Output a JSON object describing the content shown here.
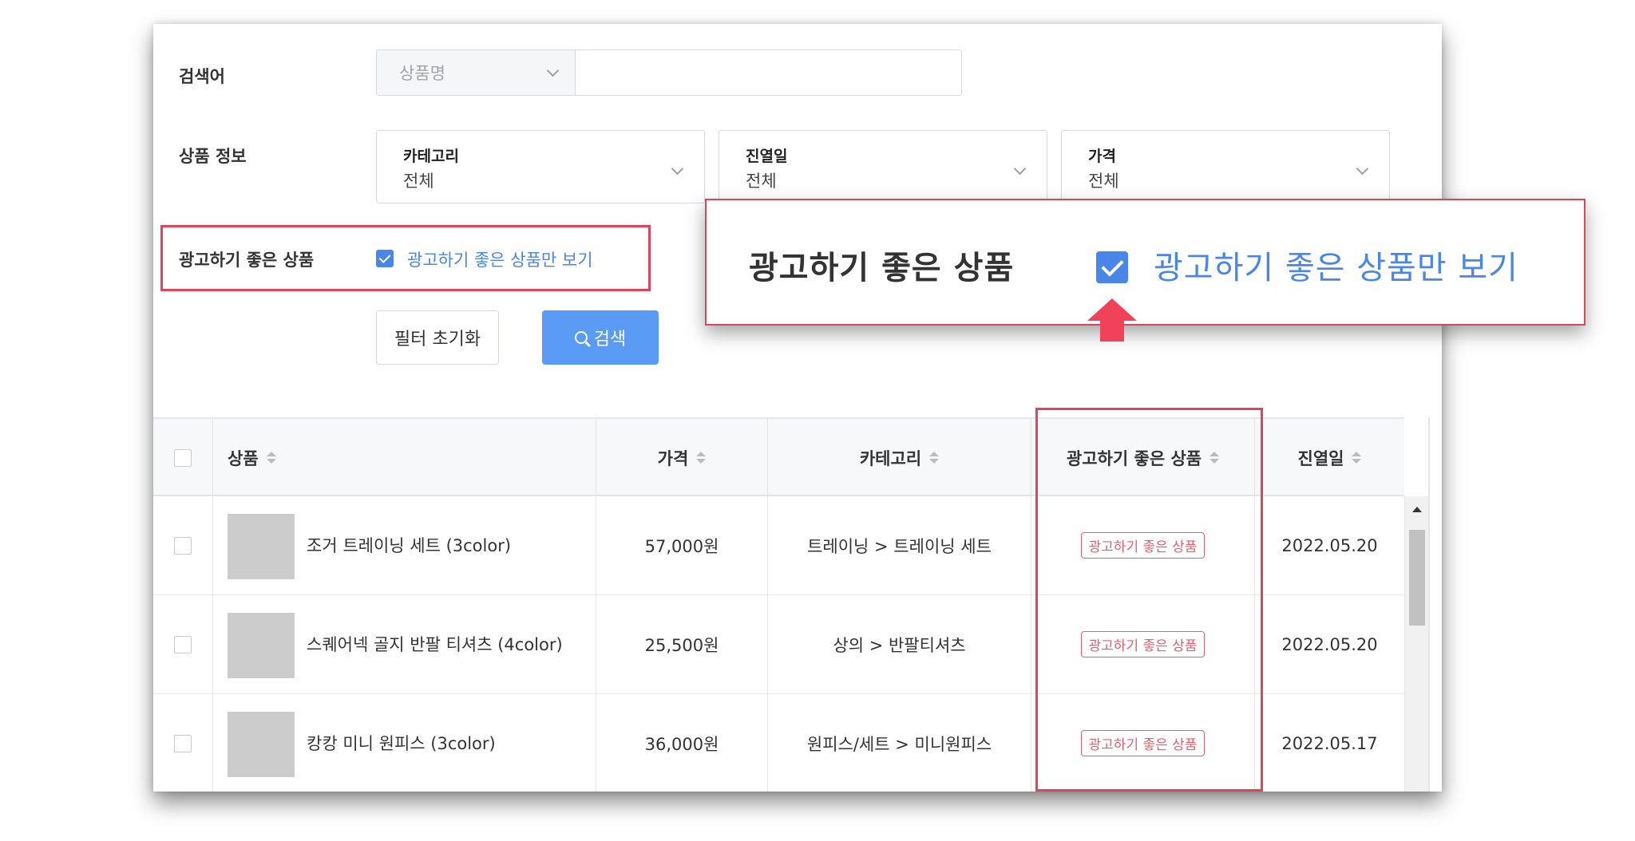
{
  "filters": {
    "search_label": "검색어",
    "search_select_value": "상품명",
    "search_input_value": "",
    "product_info_label": "상품 정보",
    "dropdowns": [
      {
        "title": "카테고리",
        "value": "전체"
      },
      {
        "title": "진열일",
        "value": "전체"
      },
      {
        "title": "가격",
        "value": "전체"
      }
    ],
    "ad_label": "광고하기 좋은 상품",
    "ad_checkbox_label": "광고하기 좋은 상품만 보기",
    "ad_checkbox_checked": true,
    "reset_button": "필터 초기화",
    "search_button": "검색"
  },
  "table": {
    "columns": [
      "상품",
      "가격",
      "카테고리",
      "광고하기 좋은 상품",
      "진열일"
    ],
    "rows": [
      {
        "name": "조거 트레이닝 세트 (3color)",
        "price": "57,000원",
        "category": "트레이닝 > 트레이닝 세트",
        "tag": "광고하기 좋은 상품",
        "date": "2022.05.20"
      },
      {
        "name": "스퀘어넥 골지 반팔 티셔츠 (4color)",
        "price": "25,500원",
        "category": "상의 > 반팔티셔츠",
        "tag": "광고하기 좋은 상품",
        "date": "2022.05.20"
      },
      {
        "name": "캉캉 미니 원피스 (3color)",
        "price": "36,000원",
        "category": "원피스/세트 > 미니원피스",
        "tag": "광고하기 좋은 상품",
        "date": "2022.05.17"
      }
    ]
  },
  "callout": {
    "label": "광고하기 좋은 상품",
    "checkbox_label": "광고하기 좋은 상품만 보기"
  },
  "colors": {
    "accent": "#4a86e8",
    "primary_button": "#5a9bf5",
    "highlight": "#e0435a",
    "tag": "#e4606f"
  }
}
